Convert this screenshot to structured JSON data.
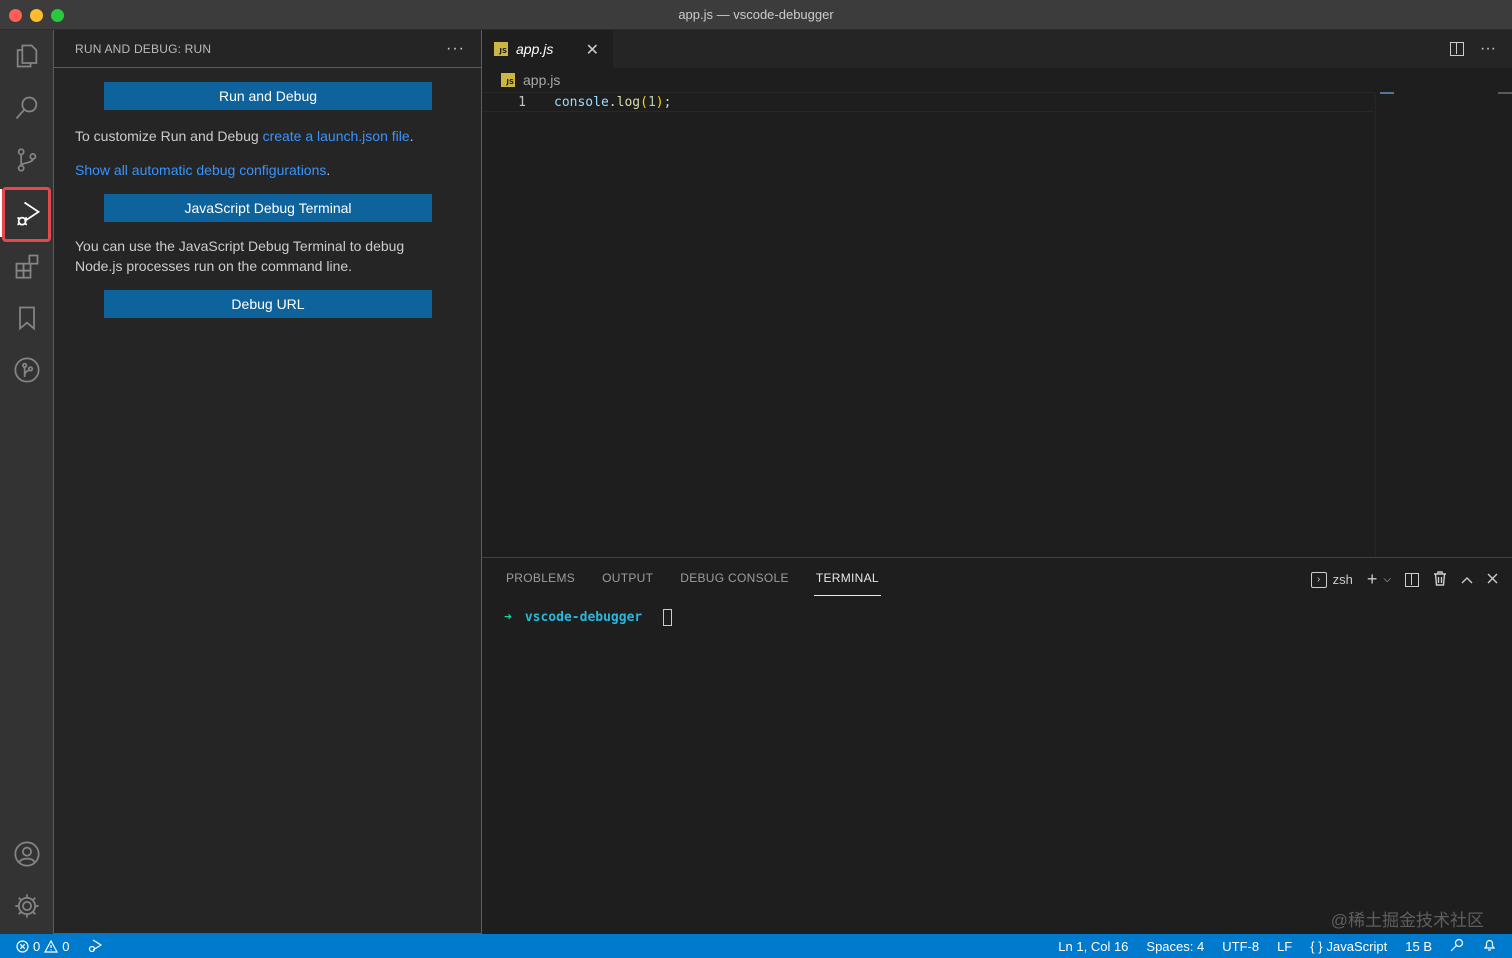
{
  "window": {
    "title": "app.js — vscode-debugger"
  },
  "activity_bar": {
    "items": [
      {
        "name": "explorer-icon"
      },
      {
        "name": "search-icon"
      },
      {
        "name": "source-control-icon"
      },
      {
        "name": "run-debug-icon",
        "active": true
      },
      {
        "name": "extensions-icon"
      },
      {
        "name": "bookmark-icon"
      },
      {
        "name": "git-graph-icon"
      }
    ],
    "bottom": [
      {
        "name": "account-icon"
      },
      {
        "name": "settings-gear-icon"
      }
    ]
  },
  "sidebar": {
    "title": "RUN AND DEBUG: RUN",
    "more": "···",
    "run_button": "Run and Debug",
    "customize_text": "To customize Run and Debug ",
    "customize_link": "create a launch.json file",
    "customize_end": ".",
    "show_link": "Show all automatic debug configurations",
    "show_end": ".",
    "js_terminal_button": "JavaScript Debug Terminal",
    "js_terminal_desc_1": "You can use the JavaScript Debug Terminal to debug",
    "js_terminal_desc_2": "Node.js processes run on the command line.",
    "debug_url_button": "Debug URL"
  },
  "editor": {
    "tab": {
      "label": "app.js",
      "icon_text": "JS",
      "close": "✕"
    },
    "actions_more": "···",
    "breadcrumb": "app.js",
    "lines": [
      {
        "number": "1",
        "tokens": {
          "obj": "console",
          "dot": ".",
          "fn": "log",
          "open": "(",
          "arg": "1",
          "close": ")",
          "semi": ";"
        }
      }
    ]
  },
  "panel": {
    "tabs": [
      {
        "label": "PROBLEMS",
        "active": false
      },
      {
        "label": "OUTPUT",
        "active": false
      },
      {
        "label": "DEBUG CONSOLE",
        "active": false
      },
      {
        "label": "TERMINAL",
        "active": true
      }
    ],
    "shell": "zsh",
    "terminal": {
      "arrow": "➜",
      "dir": "vscode-debugger"
    },
    "watermark": "@稀土掘金技术社区"
  },
  "statusbar": {
    "errors": "0",
    "warnings": "0",
    "position": "Ln 1, Col 16",
    "spaces": "Spaces: 4",
    "encoding": "UTF-8",
    "eol": "LF",
    "language": "JavaScript",
    "size": "15 B"
  },
  "colors": {
    "accent": "#007acc",
    "button": "#0e639c",
    "link": "#3794ff",
    "highlight": "#e5484d"
  }
}
